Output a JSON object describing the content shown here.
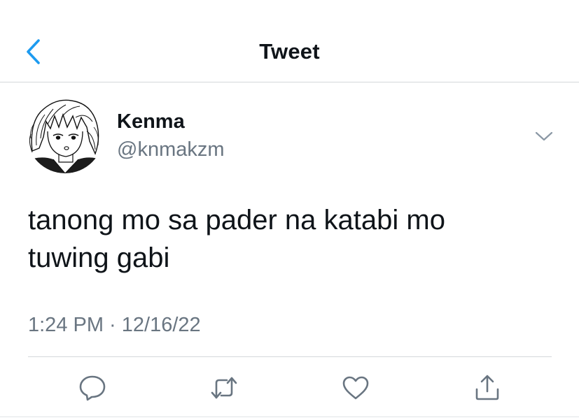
{
  "theme": {
    "accent": "#1d9bf0",
    "text_primary": "#0f1419",
    "text_secondary": "#697581",
    "icon_gray": "#697581",
    "divider": "#d4d7da"
  },
  "header": {
    "back_icon": "chevron-left-icon",
    "title": "Tweet"
  },
  "tweet": {
    "author": {
      "display_name": "Kenma",
      "handle": "@knmakzm",
      "avatar": "manga-character-avatar"
    },
    "menu_icon": "chevron-down-icon",
    "text_line_1": "tanong mo sa pader na katabi mo",
    "text_line_2": "tuwing gabi",
    "timestamp": "1:24 PM · 12/16/22"
  },
  "actions": [
    {
      "name": "reply",
      "icon": "speech-bubble-icon"
    },
    {
      "name": "retweet",
      "icon": "retweet-icon"
    },
    {
      "name": "like",
      "icon": "heart-icon"
    },
    {
      "name": "share",
      "icon": "share-icon"
    }
  ]
}
